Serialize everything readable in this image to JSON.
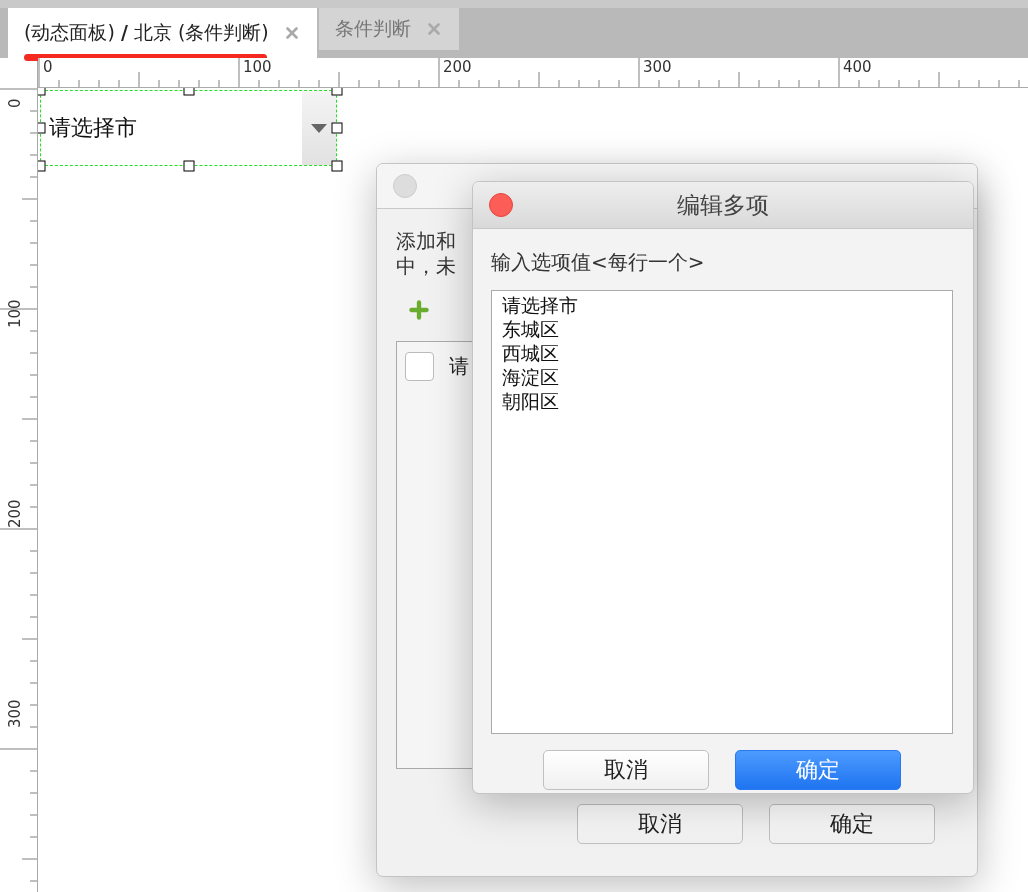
{
  "tabs": [
    {
      "label": "(动态面板) **/** 北京 (条件判断)",
      "selected": true
    },
    {
      "label": "条件判断",
      "selected": false
    }
  ],
  "horizontal_ruler": [
    "0",
    "100",
    "200",
    "300",
    "400"
  ],
  "vertical_ruler": [
    "0",
    "100",
    "200",
    "300"
  ],
  "widget": {
    "text": "请选择市",
    "selected": true
  },
  "back_dialog": {
    "intro_lines": [
      "添加和",
      "中，未"
    ],
    "list_items": [
      {
        "label": "请",
        "checked": false
      }
    ],
    "buttons": [
      "取消",
      "确定"
    ]
  },
  "front_dialog": {
    "title": "编辑多项",
    "prompt": "输入选项值<每行一个>",
    "lines": [
      "请选择市",
      "东城区",
      "西城区",
      "海淀区",
      "朝阳区"
    ],
    "buttons": [
      {
        "label": "取消",
        "primary": false
      },
      {
        "label": "确定",
        "primary": true
      }
    ]
  }
}
